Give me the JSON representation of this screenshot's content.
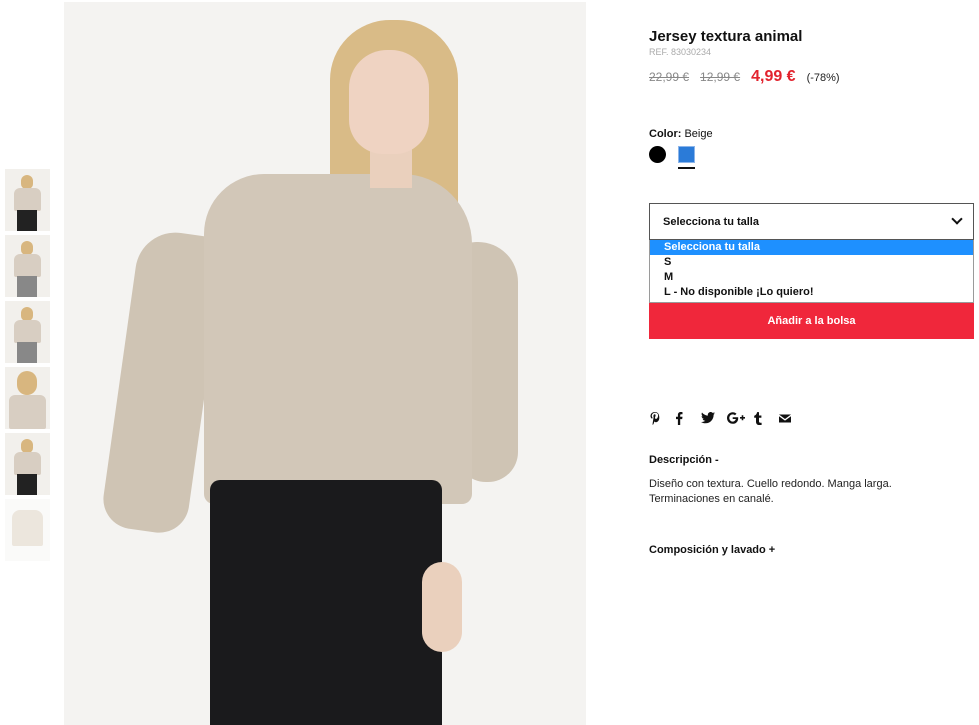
{
  "product": {
    "title": "Jersey textura animal",
    "ref": "REF. 83030234",
    "price_original": "22,99 €",
    "price_previous": "12,99 €",
    "price_current": "4,99 €",
    "discount": "(-78%)"
  },
  "color": {
    "label": "Color:",
    "selected": "Beige",
    "swatches": [
      {
        "name": "black",
        "hex": "#000000"
      },
      {
        "name": "blue",
        "hex": "#2b7bd8"
      }
    ]
  },
  "size": {
    "select_label": "Selecciona tu talla",
    "options": [
      "Selecciona tu talla",
      "S",
      "M",
      "L - No disponible ¡Lo quiero!"
    ],
    "selected_index": 0
  },
  "actions": {
    "add_to_bag": "Añadir a la bolsa"
  },
  "social": [
    "pinterest-icon",
    "facebook-icon",
    "twitter-icon",
    "google-plus-icon",
    "tumblr-icon",
    "email-icon"
  ],
  "description": {
    "title": "Descripción -",
    "body": "Diseño con textura. Cuello redondo. Manga larga. Terminaciones en canalé."
  },
  "composition": {
    "title": "Composición y lavado +"
  },
  "colors": {
    "accent_red": "#e2232e",
    "button_red": "#f0273b",
    "option_highlight": "#1e90ff"
  }
}
